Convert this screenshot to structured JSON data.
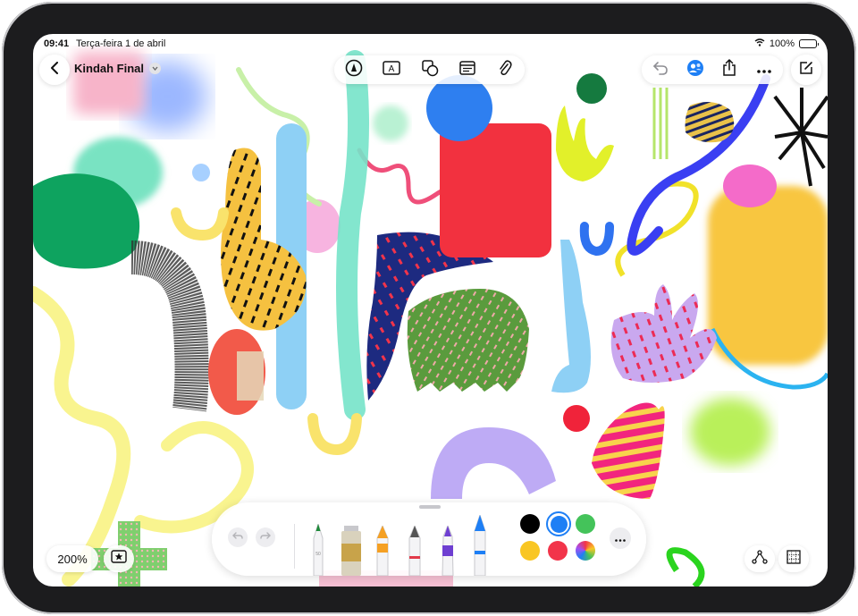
{
  "status_bar": {
    "time": "09:41",
    "date": "Terça-feira 1 de abril",
    "battery": "100%"
  },
  "document": {
    "title": "Kindah Final"
  },
  "toolbar_center": {
    "buttons": [
      {
        "name": "pen-tool",
        "icon": "markup-circle-icon"
      },
      {
        "name": "text-box",
        "icon": "text-box-icon",
        "glyph": "A"
      },
      {
        "name": "shapes",
        "icon": "shapes-icon"
      },
      {
        "name": "sticky",
        "icon": "sticky-note-icon"
      },
      {
        "name": "attach",
        "icon": "paperclip-icon"
      }
    ]
  },
  "toolbar_right": {
    "buttons": [
      {
        "name": "undo",
        "icon": "undo-arrow-icon"
      },
      {
        "name": "collaborate",
        "icon": "collaboration-icon"
      },
      {
        "name": "share",
        "icon": "share-icon"
      },
      {
        "name": "more",
        "icon": "ellipsis-icon"
      }
    ]
  },
  "compose_icon": "compose-icon",
  "zoom": {
    "level": "200%"
  },
  "favorites_icon": "star-box-icon",
  "drawing_palette": {
    "tools": [
      "pen",
      "marker",
      "crayon",
      "fountain-pen",
      "watercolor",
      "pencil"
    ],
    "pen_label": "50",
    "colors": [
      "#000000",
      "#1e7ff5",
      "#44c35a",
      "#f9c623",
      "#f2344a",
      "multicolor"
    ],
    "selected_color": "#1e7ff5"
  },
  "bottom_right": {
    "connect_icon": "connect-shapes-icon",
    "grid_icon": "grid-icon"
  },
  "accent": "#1e7ff5"
}
